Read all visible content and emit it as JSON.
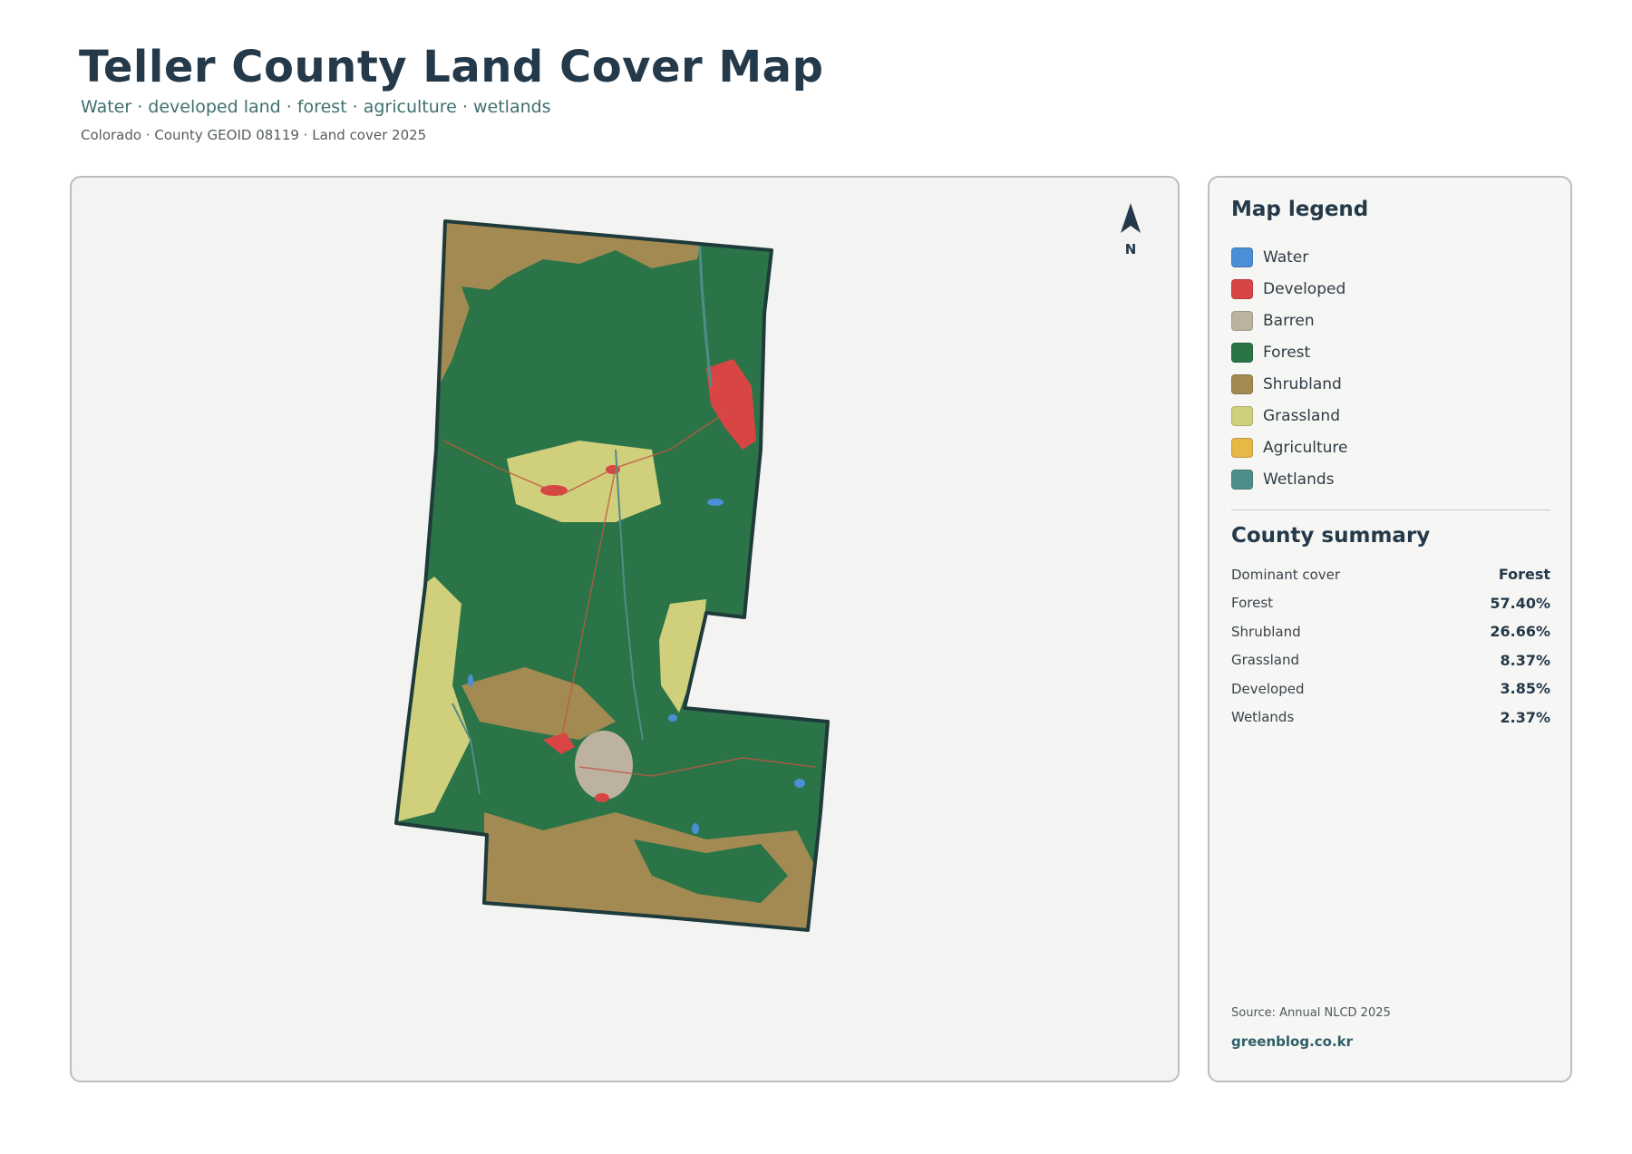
{
  "header": {
    "title": "Teller County Land Cover Map",
    "subtitle": "Water · developed land · forest · agriculture · wetlands",
    "meta": "Colorado · County GEOID 08119 · Land cover 2025"
  },
  "map": {
    "north_label": "N",
    "colors": {
      "forest": "#2b7448",
      "shrubland": "#a38a52",
      "grassland": "#cfcf7c",
      "developed": "#d94545",
      "barren": "#bdb2a0",
      "water": "#4a90d6",
      "wetlands": "#4e8e89",
      "outline": "#1f3a3a"
    }
  },
  "legend": {
    "title": "Map legend",
    "items": [
      {
        "label": "Water",
        "color": "#4a90d6"
      },
      {
        "label": "Developed",
        "color": "#d94545"
      },
      {
        "label": "Barren",
        "color": "#bdb2a0"
      },
      {
        "label": "Forest",
        "color": "#2b7448"
      },
      {
        "label": "Shrubland",
        "color": "#a38a52"
      },
      {
        "label": "Grassland",
        "color": "#cfcf7c"
      },
      {
        "label": "Agriculture",
        "color": "#e6b845"
      },
      {
        "label": "Wetlands",
        "color": "#4e8e89"
      }
    ]
  },
  "summary": {
    "title": "County summary",
    "rows": [
      {
        "key": "Dominant cover",
        "value": "Forest"
      },
      {
        "key": "Forest",
        "value": "57.40%"
      },
      {
        "key": "Shrubland",
        "value": "26.66%"
      },
      {
        "key": "Grassland",
        "value": "8.37%"
      },
      {
        "key": "Developed",
        "value": "3.85%"
      },
      {
        "key": "Wetlands",
        "value": "2.37%"
      }
    ]
  },
  "footer": {
    "source": "Source: Annual NLCD 2025",
    "brand": "greenblog.co.kr"
  }
}
